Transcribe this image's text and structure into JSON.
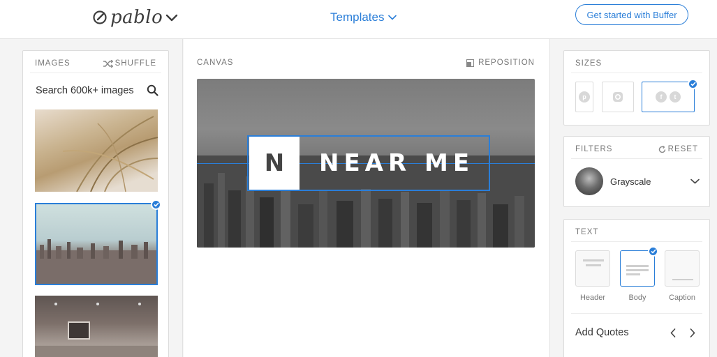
{
  "header": {
    "logo_text": "pablo",
    "templates_label": "Templates",
    "cta_label": "Get started with Buffer"
  },
  "images_panel": {
    "title": "IMAGES",
    "shuffle_label": "SHUFFLE",
    "search_placeholder": "Search 600k+ images",
    "selected_index": 1
  },
  "canvas": {
    "title": "CANVAS",
    "reposition_label": "REPOSITION",
    "logo_letter": "N",
    "headline": "NEAR ME"
  },
  "sizes": {
    "title": "SIZES",
    "options": [
      "pinterest",
      "instagram",
      "facebook-twitter"
    ],
    "selected": "facebook-twitter"
  },
  "filters": {
    "title": "FILTERS",
    "reset_label": "RESET",
    "current": "Grayscale"
  },
  "text_panel": {
    "title": "TEXT",
    "styles": [
      "Header",
      "Body",
      "Caption"
    ],
    "selected_style": "Body",
    "add_quotes_label": "Add Quotes"
  },
  "colors": {
    "accent": "#2a7ed8",
    "background": "#f4f4f4",
    "panel": "#ffffff"
  }
}
